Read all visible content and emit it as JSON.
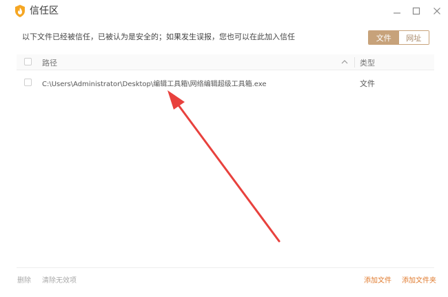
{
  "window": {
    "title": "信任区"
  },
  "hint": "以下文件已经被信任，已被认为是安全的；如果发生误报，您也可以在此加入信任",
  "tabs": [
    {
      "label": "文件",
      "active": true
    },
    {
      "label": "网址",
      "active": false
    }
  ],
  "table": {
    "columns": {
      "path": "路径",
      "type": "类型"
    },
    "rows": [
      {
        "path": "C:\\Users\\Administrator\\Desktop\\编辑工具箱\\网络编辑超级工具箱.exe",
        "type": "文件"
      }
    ]
  },
  "footer": {
    "delete": "删除",
    "clear_invalid": "清除无效项",
    "add_file": "添加文件",
    "add_folder": "添加文件夹"
  },
  "colors": {
    "accent": "#c7a27a",
    "link_orange": "#e07b2e",
    "arrow": "#e8413d"
  }
}
